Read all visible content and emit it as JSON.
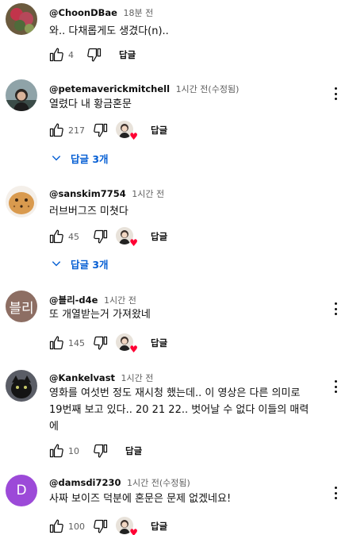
{
  "comments": [
    {
      "author": "@ChoonDBae",
      "time": "18분 전",
      "text": "와.. 다채롭게도 생겼다(n)..",
      "likes": "4",
      "reply_label": "답글"
    },
    {
      "author": "@petemaverickmitchell",
      "time": "1시간 전(수정됨)",
      "text": "열렸다 내 황금혼문",
      "likes": "217",
      "reply_label": "답글",
      "replies_label": "답글 3개"
    },
    {
      "author": "@sanskim7754",
      "time": "1시간 전",
      "text": "러브버그즈 미쳣다",
      "likes": "45",
      "reply_label": "답글",
      "replies_label": "답글 3개"
    },
    {
      "author": "@블리-d4e",
      "time": "1시간 전",
      "text": "또 개열받는거 가져왔네",
      "likes": "145",
      "reply_label": "답글",
      "avatar_letter": "블리"
    },
    {
      "author": "@Kankelvast",
      "time": "1시간 전",
      "text_lines": [
        "영화를 여섯번 정도 재시청 했는데.. 이 영상은 다른 의미로",
        "19번째 보고 있다.. 20 21 22.. 벗어날 수 없다 이들의 매력",
        "에"
      ],
      "likes": "10",
      "reply_label": "답글"
    },
    {
      "author": "@damsdi7230",
      "time": "1시간 전(수정됨)",
      "text": "사짜 보이즈 덕분에 혼문은 문제 없겠네요!",
      "likes": "100",
      "reply_label": "답글",
      "avatar_letter": "D"
    }
  ],
  "colors": {
    "link_blue": "#065fd4",
    "heart_red": "#ff0033",
    "avatar_brown": "#8d6e63",
    "avatar_purple": "#9c4ad8"
  }
}
